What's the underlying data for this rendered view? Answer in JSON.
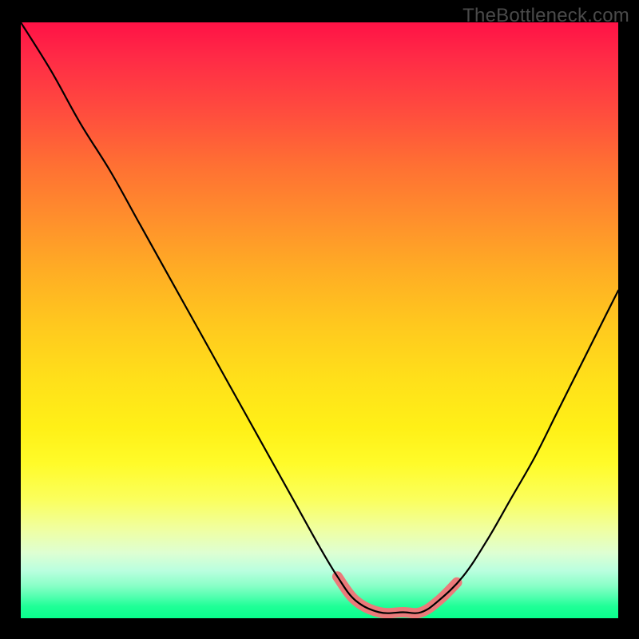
{
  "watermark": "TheBottleneck.com",
  "chart_data": {
    "type": "line",
    "title": "",
    "xlabel": "",
    "ylabel": "",
    "xlim": [
      0,
      100
    ],
    "ylim": [
      0,
      100
    ],
    "grid": false,
    "legend": false,
    "note": "Abstract bottleneck curve over a vertical rainbow gradient. Y reads as bottleneck severity (top=red=high, bottom=green=low). X is an unlabeled balance axis. A pink highlight marks the near-zero-bottleneck flat region around x≈56–70.",
    "series": [
      {
        "name": "bottleneck-curve",
        "stroke": "#000000",
        "x": [
          0,
          5,
          10,
          15,
          20,
          25,
          30,
          35,
          40,
          45,
          50,
          53,
          56,
          60,
          64,
          67,
          70,
          74,
          78,
          82,
          86,
          90,
          94,
          98,
          100
        ],
        "values": [
          100,
          92,
          83,
          75,
          66,
          57,
          48,
          39,
          30,
          21,
          12,
          7,
          3,
          1,
          1,
          1,
          3,
          7,
          13,
          20,
          27,
          35,
          43,
          51,
          55
        ]
      },
      {
        "name": "optimal-range-highlight",
        "stroke": "#eb7a7a",
        "x": [
          53,
          56,
          60,
          64,
          67,
          70,
          73
        ],
        "values": [
          7,
          3,
          1,
          1,
          1,
          3,
          6
        ]
      }
    ],
    "gradient_stops": [
      {
        "pos": 0.0,
        "color": "#ff1246"
      },
      {
        "pos": 0.25,
        "color": "#ff8030"
      },
      {
        "pos": 0.55,
        "color": "#ffe018"
      },
      {
        "pos": 0.82,
        "color": "#f6ff70"
      },
      {
        "pos": 1.0,
        "color": "#09ff8d"
      }
    ]
  }
}
